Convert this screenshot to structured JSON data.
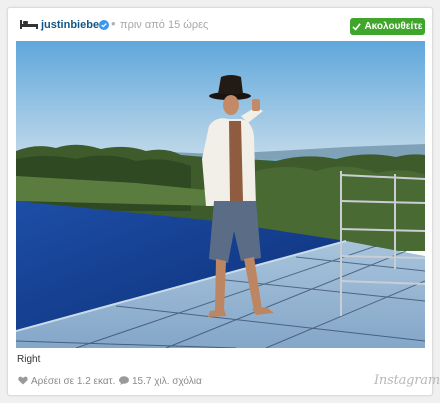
{
  "post": {
    "username": "justinbieber",
    "time_ago": "πριν από 15 ώρες",
    "follow_label": "Ακολουθείτε",
    "caption": "Right",
    "likes": "Αρέσει σε 1.2 εκατ.",
    "comments": "15.7 χιλ. σχόλια",
    "platform_logo": "Instagram"
  },
  "icons": {
    "avatar": "bed-icon",
    "verified": "verified-badge-icon",
    "follow": "checkmark-icon",
    "like": "heart-icon",
    "comment": "speech-bubble-icon"
  },
  "colors": {
    "username": "#125688",
    "follow_button": "#3fa52b",
    "muted_text": "#8a8a8a"
  }
}
